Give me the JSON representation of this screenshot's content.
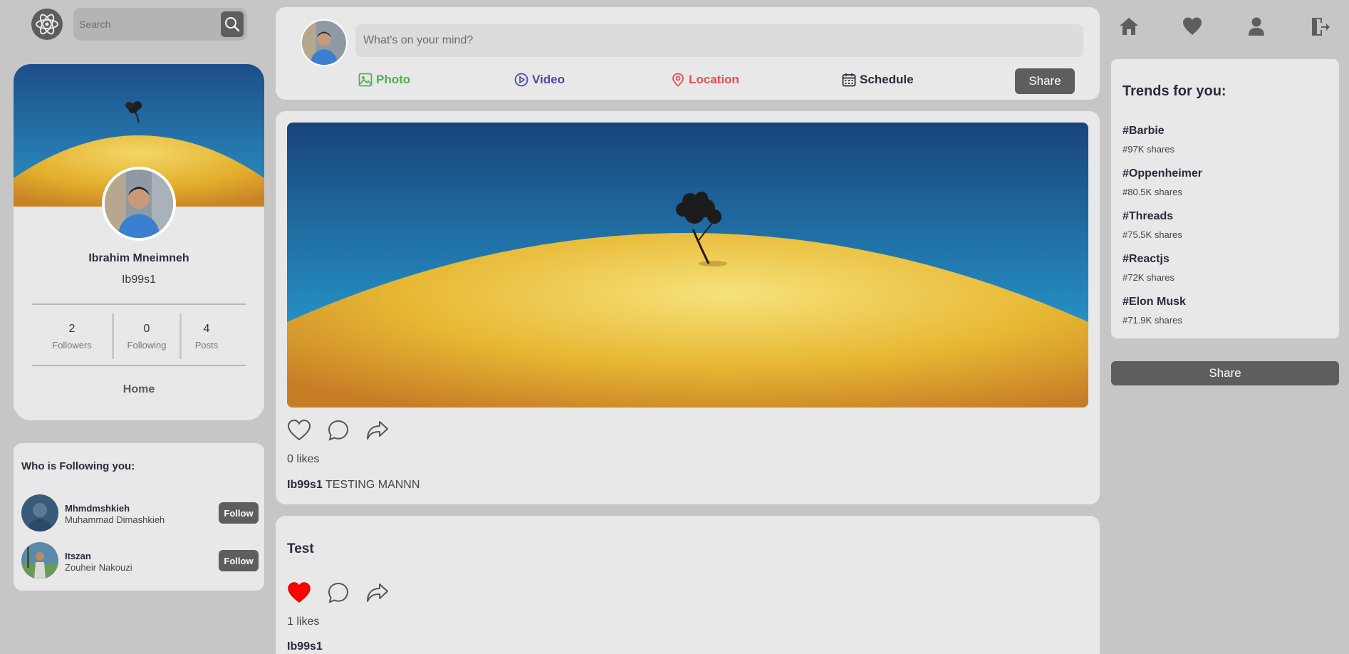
{
  "search": {
    "placeholder": "Search"
  },
  "profile": {
    "name": "Ibrahim Mneimneh",
    "handle": "Ib99s1",
    "stats": [
      {
        "value": "2",
        "label": "Followers"
      },
      {
        "value": "0",
        "label": "Following"
      },
      {
        "value": "4",
        "label": "Posts"
      }
    ],
    "home_label": "Home"
  },
  "followers": {
    "title": "Who is Following you:",
    "items": [
      {
        "username": "Mhmdmshkieh",
        "fullname": "Muhammad Dimashkieh",
        "button": "Follow"
      },
      {
        "username": "Itszan",
        "fullname": "Zouheir Nakouzi",
        "button": "Follow"
      }
    ]
  },
  "composer": {
    "placeholder": "What's on your mind?",
    "options": [
      {
        "label": "Photo",
        "color": "#4caf50",
        "icon": "image-icon"
      },
      {
        "label": "Video",
        "color": "#4a4aa8",
        "icon": "play-circle-icon"
      },
      {
        "label": "Location",
        "color": "#e05050",
        "icon": "location-pin-icon"
      },
      {
        "label": "Schedule",
        "color": "#2a2a3a",
        "icon": "calendar-icon"
      }
    ],
    "share_label": "Share"
  },
  "posts": [
    {
      "likes": "0 likes",
      "author": "Ib99s1",
      "text": "TESTING MANNN",
      "liked": false
    },
    {
      "title": "Test",
      "likes": "1 likes",
      "author": "Ib99s1",
      "liked": true
    }
  ],
  "trends": {
    "title": "Trends for you:",
    "items": [
      {
        "tag": "#Barbie",
        "shares": "#97K shares"
      },
      {
        "tag": "#Oppenheimer",
        "shares": "#80.5K shares"
      },
      {
        "tag": "#Threads",
        "shares": "#75.5K shares"
      },
      {
        "tag": "#Reactjs",
        "shares": "#72K shares"
      },
      {
        "tag": "#Elon Musk",
        "shares": "#71.9K shares"
      }
    ]
  },
  "right_share_label": "Share",
  "colors": {
    "accent_gray": "#5e5e5e",
    "like_red": "#ff0000"
  }
}
